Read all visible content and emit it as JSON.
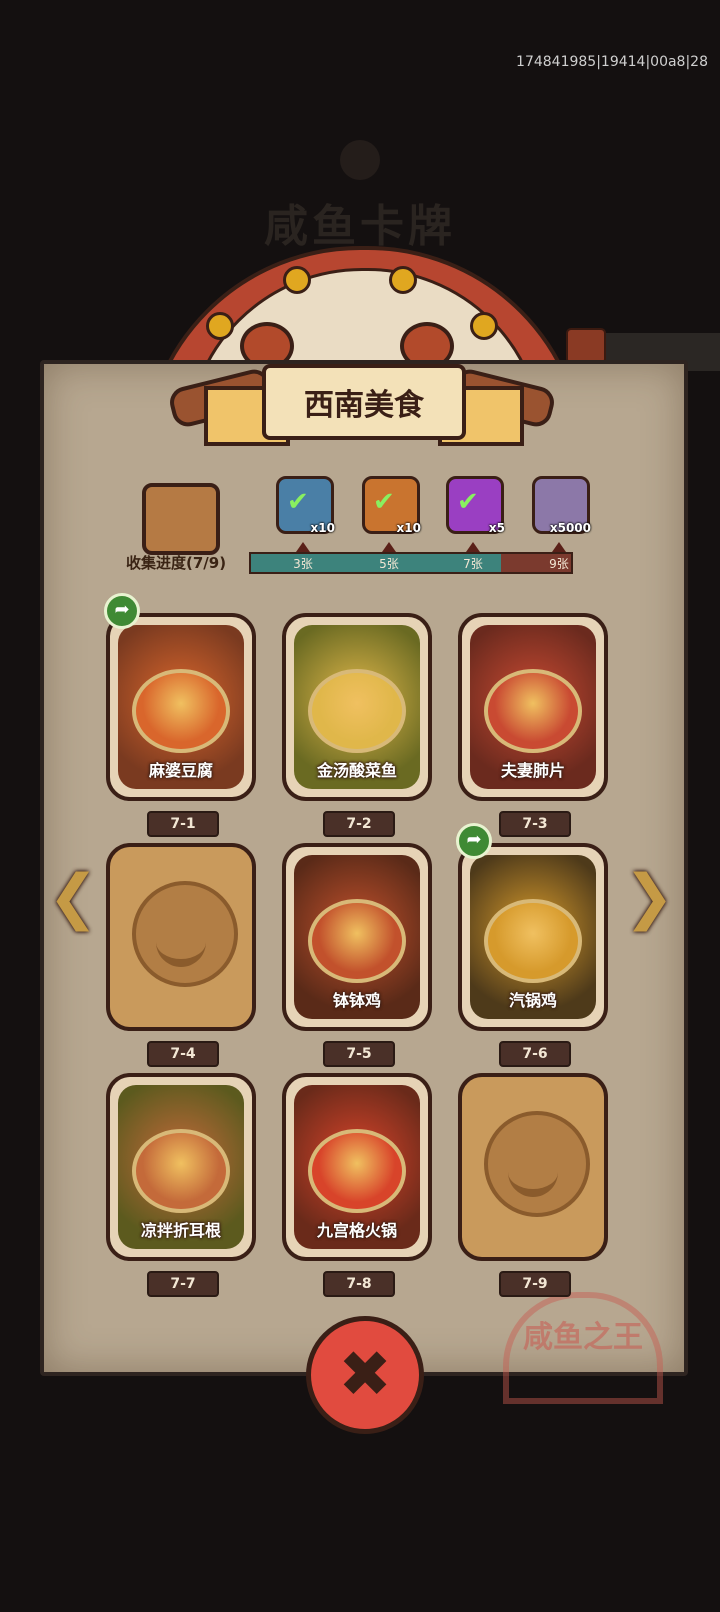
{
  "debug_text": "174841985|19414|00a8|28",
  "background_title": "咸鱼卡牌",
  "collection": {
    "title": "西南美食",
    "progress_label": "收集进度(7/9)",
    "progress_fraction": 0.78,
    "milestones": [
      {
        "label": "3张",
        "reward_icon": "blue-chest-check-icon",
        "reward_qty": "x10",
        "color": "#4a7fa6"
      },
      {
        "label": "5张",
        "reward_icon": "orange-ticket-check-icon",
        "reward_qty": "x10",
        "color": "#c9742f"
      },
      {
        "label": "7张",
        "reward_icon": "purple-orb-check-icon",
        "reward_qty": "x5",
        "color": "#9a3fc2"
      },
      {
        "label": "9张",
        "reward_icon": "silver-crystal-icon",
        "reward_qty": "x5000",
        "color": "#8c78a8"
      }
    ]
  },
  "cards": [
    {
      "id": "7-1",
      "name": "麻婆豆腐",
      "unlocked": true,
      "shareable": true,
      "bg": "#7a3a20",
      "plate": "#d9662c"
    },
    {
      "id": "7-2",
      "name": "金汤酸菜鱼",
      "unlocked": true,
      "shareable": false,
      "bg": "#6a6a22",
      "plate": "#e0b74a"
    },
    {
      "id": "7-3",
      "name": "夫妻肺片",
      "unlocked": true,
      "shareable": false,
      "bg": "#6b2a1e",
      "plate": "#c94a32"
    },
    {
      "id": "7-4",
      "name": "",
      "unlocked": false,
      "shareable": false,
      "bg": "#c99a5c",
      "plate": "#b27e45"
    },
    {
      "id": "7-5",
      "name": "钵钵鸡",
      "unlocked": true,
      "shareable": false,
      "bg": "#5a2a18",
      "plate": "#c2512c"
    },
    {
      "id": "7-6",
      "name": "汽锅鸡",
      "unlocked": true,
      "shareable": true,
      "bg": "#4e3a1a",
      "plate": "#d69a2c"
    },
    {
      "id": "7-7",
      "name": "凉拌折耳根",
      "unlocked": true,
      "shareable": false,
      "bg": "#5c5a1e",
      "plate": "#c46a3a"
    },
    {
      "id": "7-8",
      "name": "九宫格火锅",
      "unlocked": true,
      "shareable": false,
      "bg": "#6a2a1a",
      "plate": "#d8442a"
    },
    {
      "id": "7-9",
      "name": "",
      "unlocked": false,
      "shareable": false,
      "bg": "#c99a5c",
      "plate": "#b27e45"
    }
  ],
  "nav": {
    "prev": "❮",
    "next": "❯"
  },
  "close_label": "✖",
  "share_glyph": "➦",
  "check_glyph": "✔",
  "watermark_text": "咸鱼之王"
}
